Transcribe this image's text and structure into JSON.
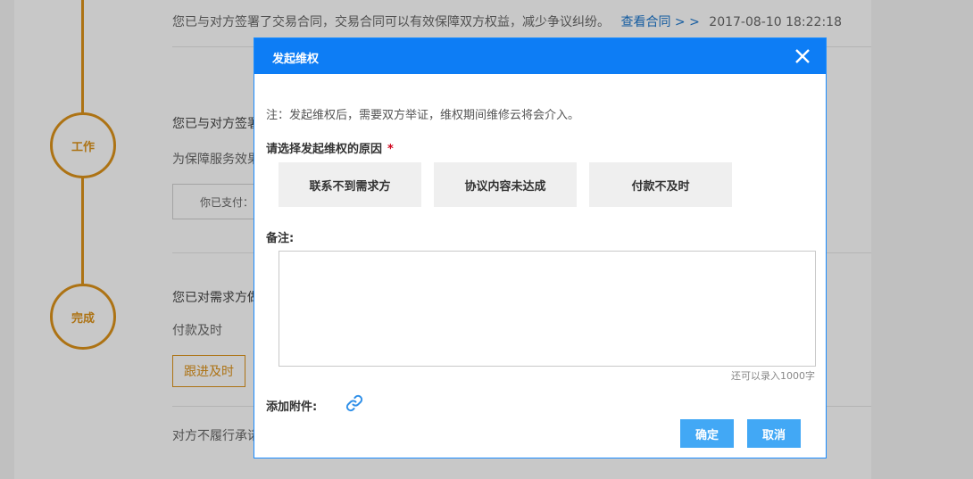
{
  "background": {
    "row1": {
      "text": "您已与对方签署了交易合同，交易合同可以有效保障双方权益，减少争议纠纷。",
      "link": "查看合同 > >",
      "time": "2017-08-10 18:22:18"
    },
    "step_work": {
      "circle_label": "工作",
      "title": "您已与对方签署",
      "subtitle": "为保障服务效果",
      "paid_box": "你已支付："
    },
    "step_done": {
      "circle_label": "完成",
      "title": "您已对需求方做",
      "status": "付款及时",
      "follow_button": "跟进及时",
      "footer": "对方不履行承诺"
    }
  },
  "modal": {
    "title": "发起维权",
    "close_icon": "close-icon",
    "note": "注：发起维权后，需要双方举证，维权期间维修云将会介入。",
    "reason_label": "请选择发起维权的原因",
    "required_mark": "*",
    "reasons": [
      "联系不到需求方",
      "协议内容未达成",
      "付款不及时"
    ],
    "remark_label": "备注:",
    "remark_value": "",
    "counter": "还可以录入1000字",
    "attach_label": "添加附件:",
    "attach_icon": "link-icon",
    "confirm": "确定",
    "cancel": "取消"
  },
  "colors": {
    "accent": "#0d7df5",
    "button": "#42a8f5",
    "timeline": "#d9901a",
    "required": "#d0021b"
  }
}
